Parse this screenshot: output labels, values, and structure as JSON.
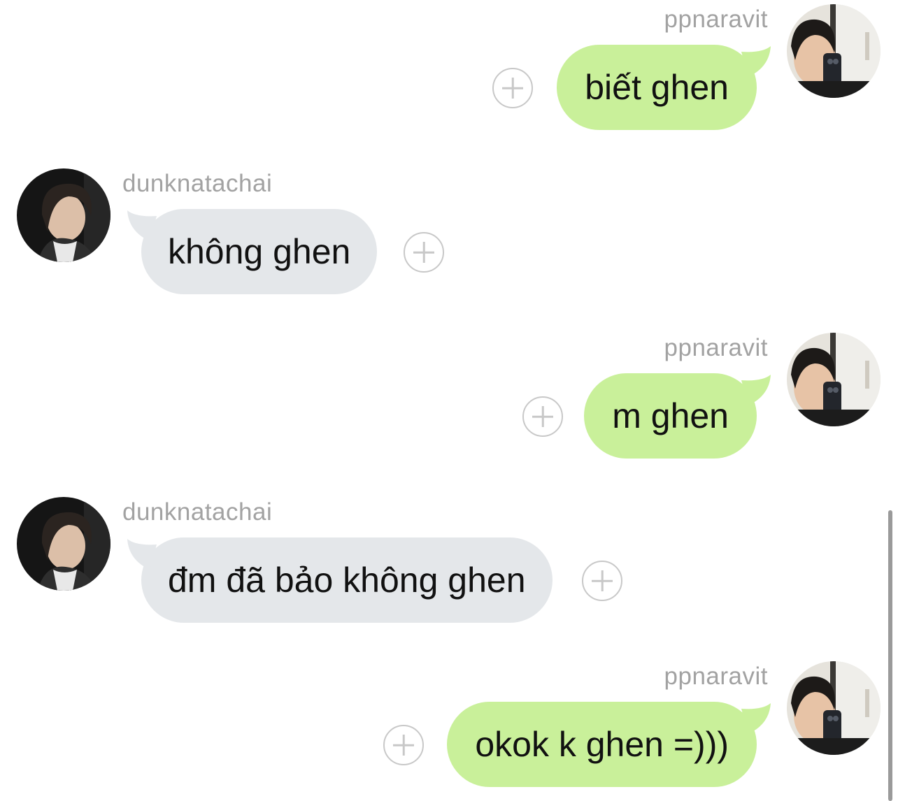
{
  "messages": [
    {
      "sender": "ppnaravit",
      "direction": "sent",
      "text": "biết ghen"
    },
    {
      "sender": "dunknatachai",
      "direction": "received",
      "text": "không ghen"
    },
    {
      "sender": "ppnaravit",
      "direction": "sent",
      "text": "m ghen"
    },
    {
      "sender": "dunknatachai",
      "direction": "received",
      "text": "đm đã bảo không ghen"
    },
    {
      "sender": "ppnaravit",
      "direction": "sent",
      "text": "okok k ghen =)))"
    }
  ],
  "colors": {
    "sent_bubble": "#c9f09a",
    "received_bubble": "#e4e7ea",
    "username": "#a2a2a2",
    "plus_icon": "#c8c8c8"
  },
  "icons": {
    "reaction_button": "plus-circle-icon",
    "avatar": "profile-photo"
  }
}
